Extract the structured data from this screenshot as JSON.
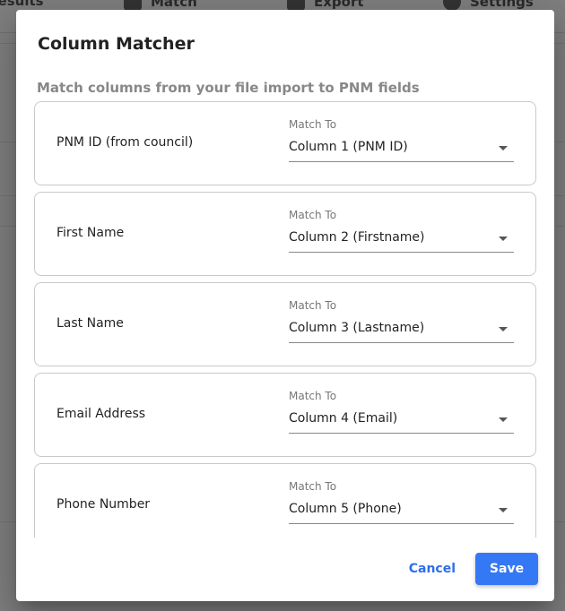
{
  "background": {
    "toolbar": [
      {
        "label": "Results",
        "icon": "results-icon"
      },
      {
        "label": "Match",
        "icon": "puzzle-icon"
      },
      {
        "label": "Export",
        "icon": "download-icon"
      },
      {
        "label": "Settings",
        "icon": "gear-icon"
      }
    ]
  },
  "dialog": {
    "title": "Column Matcher",
    "subtitle": "Match columns from your file import to PNM fields",
    "match_to_label": "Match To",
    "rows": [
      {
        "field": "PNM ID (from council)",
        "match_label": "Match To",
        "selected": "Column 1 (PNM ID)"
      },
      {
        "field": "First Name",
        "match_label": "Match To",
        "selected": "Column 2 (Firstname)"
      },
      {
        "field": "Last Name",
        "match_label": "Match To",
        "selected": "Column 3 (Lastname)"
      },
      {
        "field": "Email Address",
        "match_label": "Match To",
        "selected": "Column 4 (Email)"
      },
      {
        "field": "Phone Number",
        "match_label": "Match To",
        "selected": "Column 5 (Phone)"
      }
    ],
    "cancel_label": "Cancel",
    "save_label": "Save"
  },
  "colors": {
    "accent": "#3478f6",
    "cancel_text": "#2f6ee8",
    "scrim": "rgba(0,0,0,0.5)"
  }
}
